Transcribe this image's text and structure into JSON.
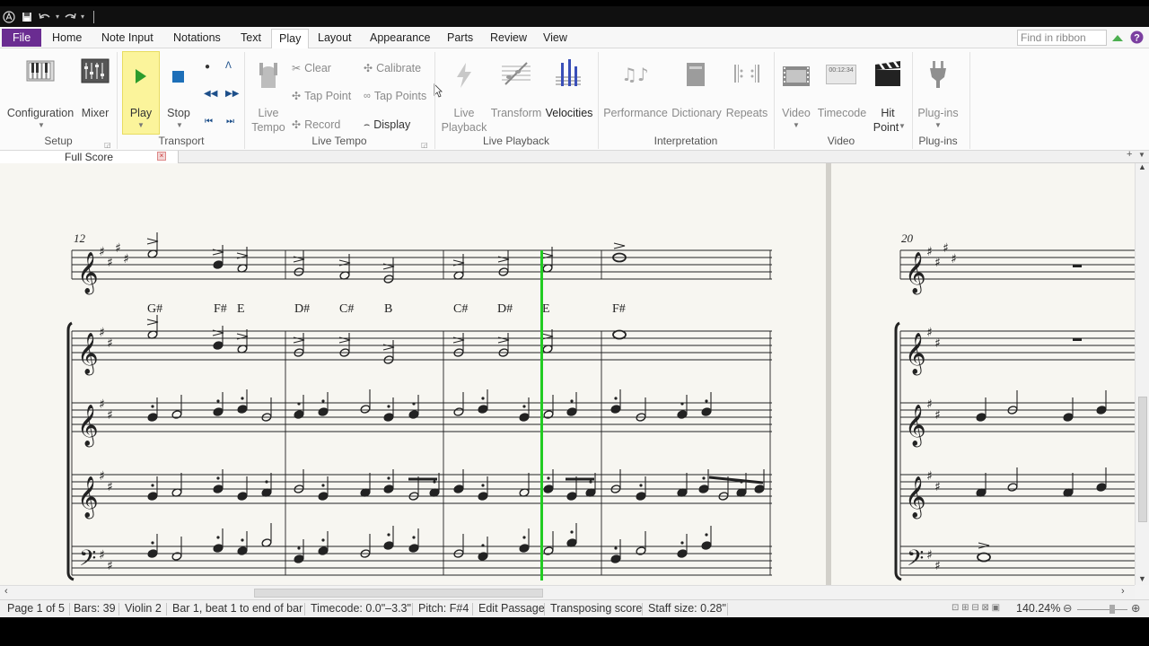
{
  "quick_access": {
    "sibelius_icon": "sibelius-logo-icon",
    "save_icon": "save-icon",
    "undo_icon": "undo-icon",
    "redo_icon": "redo-icon"
  },
  "tabs": [
    "File",
    "Home",
    "Note Input",
    "Notations",
    "Text",
    "Play",
    "Layout",
    "Appearance",
    "Parts",
    "Review",
    "View"
  ],
  "active_tab": "Play",
  "search_placeholder": "Find in ribbon",
  "ribbon": {
    "setup": {
      "label": "Setup",
      "configuration": "Configuration",
      "mixer": "Mixer"
    },
    "transport": {
      "label": "Transport",
      "play": "Play",
      "stop": "Stop"
    },
    "live_tempo": {
      "label": "Live Tempo",
      "live_tempo_line1": "Live",
      "live_tempo_line2": "Tempo",
      "clear": "Clear",
      "tap_point": "Tap Point",
      "record": "Record",
      "calibrate": "Calibrate",
      "tap_points": "Tap Points",
      "display": "Display"
    },
    "live_playback": {
      "label": "Live Playback",
      "live_playback_line1": "Live",
      "live_playback_line2": "Playback",
      "transform": "Transform",
      "velocities": "Velocities"
    },
    "interpretation": {
      "label": "Interpretation",
      "performance": "Performance",
      "dictionary": "Dictionary",
      "repeats": "Repeats"
    },
    "video": {
      "label": "Video",
      "video": "Video",
      "timecode": "Timecode",
      "timecode_display": "00:12:34",
      "hit_point_line1": "Hit",
      "hit_point_line2": "Point"
    },
    "plugins": {
      "label": "Plug-ins",
      "plugins": "Plug-ins"
    }
  },
  "document_tab": "Full Score",
  "score": {
    "bar_number_left": "12",
    "bar_number_right": "20",
    "chord_symbols": [
      "G#",
      "F#",
      "E",
      "D#",
      "C#",
      "B",
      "C#",
      "D#",
      "E",
      "F#"
    ]
  },
  "status": {
    "page": "Page 1 of 5",
    "bars": "Bars: 39",
    "instrument": "Violin 2",
    "selection": "Bar 1, beat 1 to end of bar",
    "timecode": "Timecode: 0.0\"–3.3\"",
    "pitch": "Pitch: F#4",
    "mode": "Edit Passage",
    "transposing": "Transposing score",
    "staff_size": "Staff size: 0.28\"",
    "zoom": "140.24%"
  },
  "colors": {
    "file_tab": "#6a2c91",
    "play_highlight": "#fbf49b",
    "playback_line": "#22cc22",
    "paper": "#f7f6f1"
  }
}
